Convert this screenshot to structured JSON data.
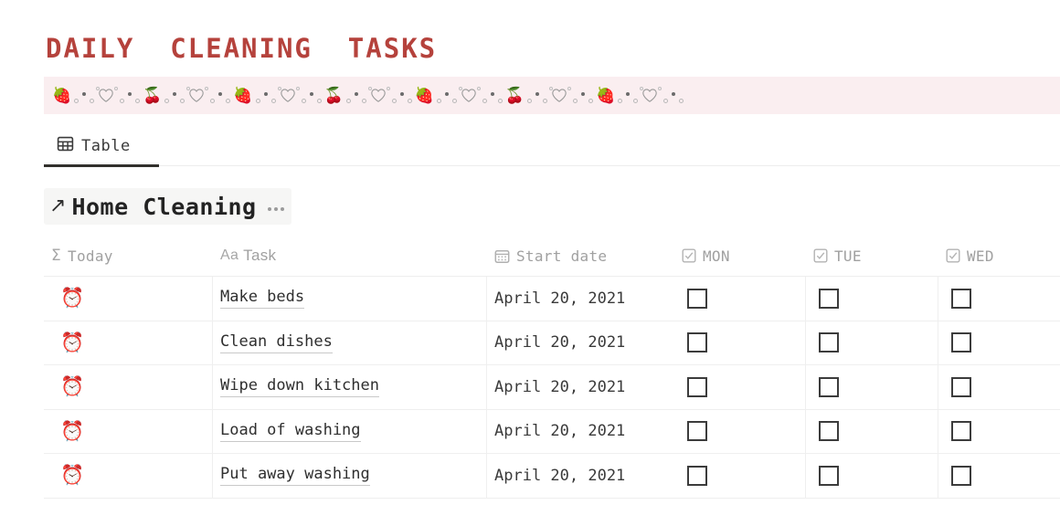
{
  "header": {
    "title": "DAILY  CLEANING  TASKS",
    "title_color": "#b5423c",
    "banner_bg": "#faeef0",
    "banner_icons": [
      "strawberry",
      "heart-outline",
      "cherries",
      "heart-outline"
    ]
  },
  "tabs": [
    {
      "label": "Table",
      "icon": "table-icon",
      "active": true
    }
  ],
  "collection": {
    "title": "Home Cleaning",
    "link_icon": "arrow-up-right-icon",
    "menu_icon": "ellipsis-icon"
  },
  "table": {
    "columns": [
      {
        "key": "today",
        "label": "Today",
        "icon": "sigma-formula-icon"
      },
      {
        "key": "task",
        "label": "Task",
        "icon": "aa-text-icon"
      },
      {
        "key": "date",
        "label": "Start date",
        "icon": "calendar-icon"
      },
      {
        "key": "mon",
        "label": "MON",
        "icon": "checkbox-icon"
      },
      {
        "key": "tue",
        "label": "TUE",
        "icon": "checkbox-icon"
      },
      {
        "key": "wed",
        "label": "WED",
        "icon": "checkbox-icon"
      }
    ],
    "rows": [
      {
        "today": "⏰",
        "task": "Make beds",
        "date": "April 20, 2021",
        "mon": false,
        "tue": false,
        "wed": false
      },
      {
        "today": "⏰",
        "task": "Clean dishes",
        "date": "April 20, 2021",
        "mon": false,
        "tue": false,
        "wed": false
      },
      {
        "today": "⏰",
        "task": "Wipe down kitchen",
        "date": "April 20, 2021",
        "mon": false,
        "tue": false,
        "wed": false
      },
      {
        "today": "⏰",
        "task": "Load of washing",
        "date": "April 20, 2021",
        "mon": false,
        "tue": false,
        "wed": false
      },
      {
        "today": "⏰",
        "task": "Put away washing",
        "date": "April 20, 2021",
        "mon": false,
        "tue": false,
        "wed": false
      }
    ]
  }
}
